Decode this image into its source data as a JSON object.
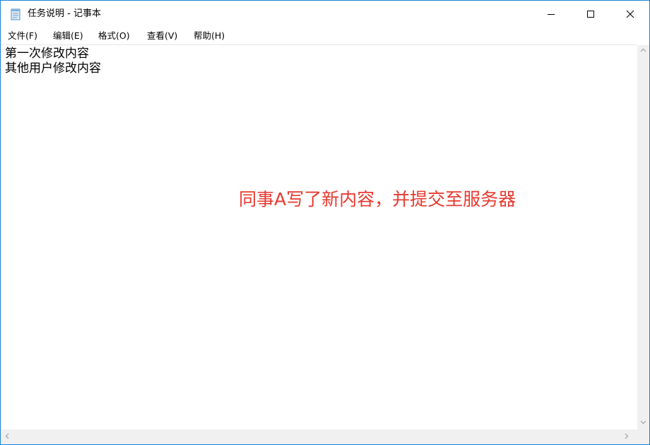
{
  "window": {
    "title": "任务说明 - 记事本"
  },
  "menu": {
    "items": [
      "文件(F)",
      "编辑(E)",
      "格式(O)",
      "查看(V)",
      "帮助(H)"
    ]
  },
  "editor": {
    "lines": [
      "第一次修改内容",
      "其他用户修改内容"
    ],
    "annotation": "同事A写了新内容，并提交至服务器"
  },
  "colors": {
    "annotation": "#e8392f",
    "window_border": "#1883d7"
  },
  "icons": {
    "app": "notepad-icon",
    "minimize": "minimize-icon",
    "maximize": "maximize-icon",
    "close": "close-icon"
  }
}
